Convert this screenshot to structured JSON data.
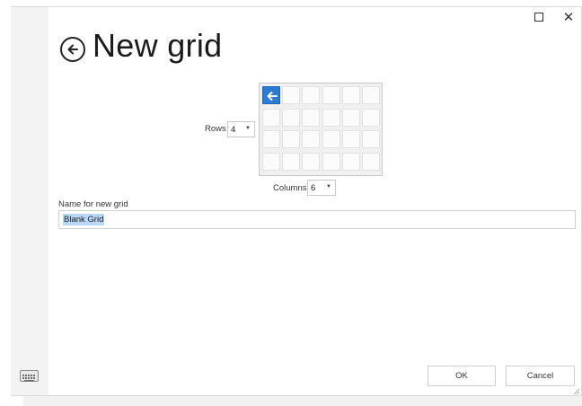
{
  "window": {
    "maximize_icon": "maximize-icon",
    "close_glyph": "✕"
  },
  "header": {
    "back_icon": "back-arrow-icon",
    "title": "New grid"
  },
  "rows": {
    "label": "Rows",
    "value": "4"
  },
  "columns": {
    "label": "Columns",
    "value": "6"
  },
  "grid_preview": {
    "rows": 4,
    "columns": 6,
    "active_cell_icon": "back-arrow-icon",
    "active_color": "#2b7bd3"
  },
  "name_field": {
    "label": "Name for new grid",
    "value": "Blank Grid"
  },
  "footer": {
    "keyboard_icon": "keyboard-icon",
    "ok_label": "OK",
    "cancel_label": "Cancel"
  }
}
